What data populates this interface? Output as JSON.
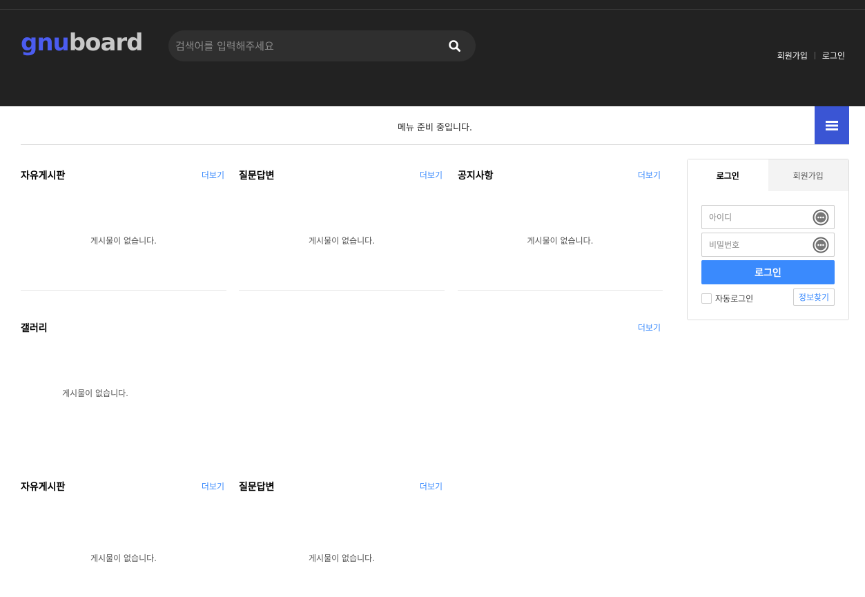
{
  "header": {
    "logo_part1": "gnu",
    "logo_part2": "board",
    "search_placeholder": "검색어를 입력해주세요",
    "signup_link": "회원가입",
    "login_link": "로그인"
  },
  "gnb": {
    "message": "메뉴 준비 중입니다."
  },
  "widgets": [
    {
      "title": "자유게시판",
      "more": "더보기",
      "empty": "게시물이 없습니다."
    },
    {
      "title": "질문답변",
      "more": "더보기",
      "empty": "게시물이 없습니다."
    },
    {
      "title": "공지사항",
      "more": "더보기",
      "empty": "게시물이 없습니다."
    },
    {
      "title": "갤러리",
      "more": "더보기",
      "empty": "게시물이 없습니다."
    },
    {
      "title": "자유게시판",
      "more": "더보기",
      "empty": "게시물이 없습니다."
    },
    {
      "title": "질문답변",
      "more": "더보기",
      "empty": "게시물이 없습니다."
    }
  ],
  "login_box": {
    "tab_login": "로그인",
    "tab_signup": "회원가입",
    "id_placeholder": "아이디",
    "pw_placeholder": "비밀번호",
    "submit": "로그인",
    "auto_login": "자동로그인",
    "find_info": "정보찾기"
  },
  "colors": {
    "header_bg": "#222222",
    "logo_accent": "#4b5cf0",
    "menu_button": "#3a55d4",
    "link_blue": "#3a8afd"
  },
  "icons": {
    "search": "search-icon",
    "menu": "hamburger-menu-icon",
    "input": "ellipsis-circle-icon"
  }
}
